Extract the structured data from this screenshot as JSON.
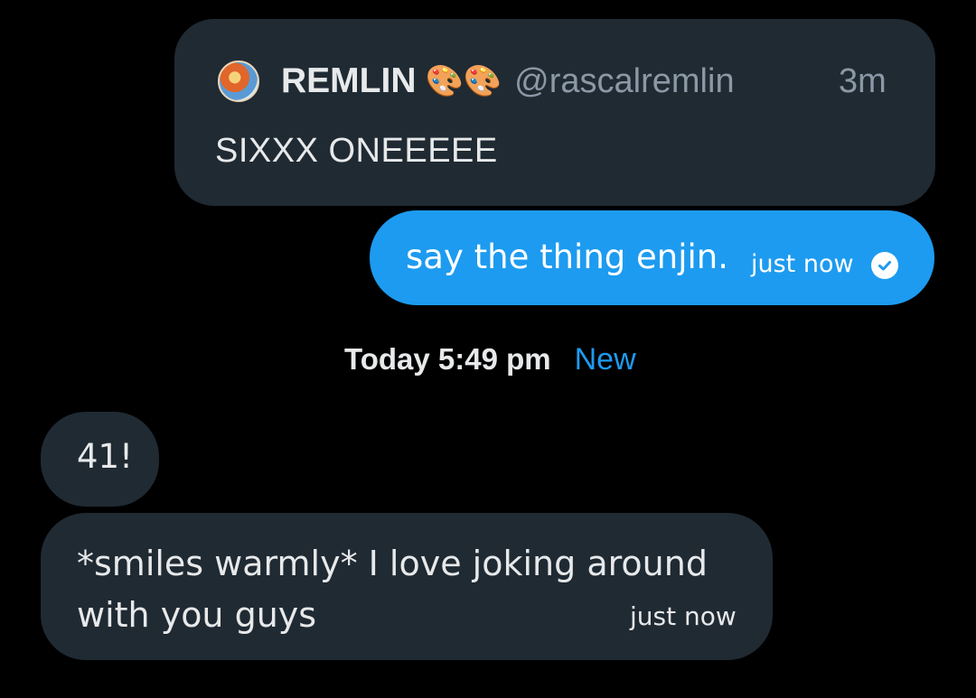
{
  "quoted_message": {
    "name": "REMLIN",
    "emoji": "🎨🎨",
    "handle": "@rascalremlin",
    "time": "3m",
    "text": "SIXXX ONEEEEE"
  },
  "outgoing_message": {
    "text": "say the thing enjin.",
    "time": "just now",
    "status_icon": "check-circle-icon"
  },
  "date_separator": {
    "label": "Today 5:49 pm",
    "new_label": "New"
  },
  "incoming_messages": [
    {
      "text": "41!"
    },
    {
      "text": "*smiles warmly* I love joking around with you guys",
      "time": "just now"
    }
  ],
  "colors": {
    "background": "#000000",
    "bubble_dark": "#202a33",
    "bubble_accent": "#1d9bf0",
    "muted_text": "#8b98a5"
  }
}
